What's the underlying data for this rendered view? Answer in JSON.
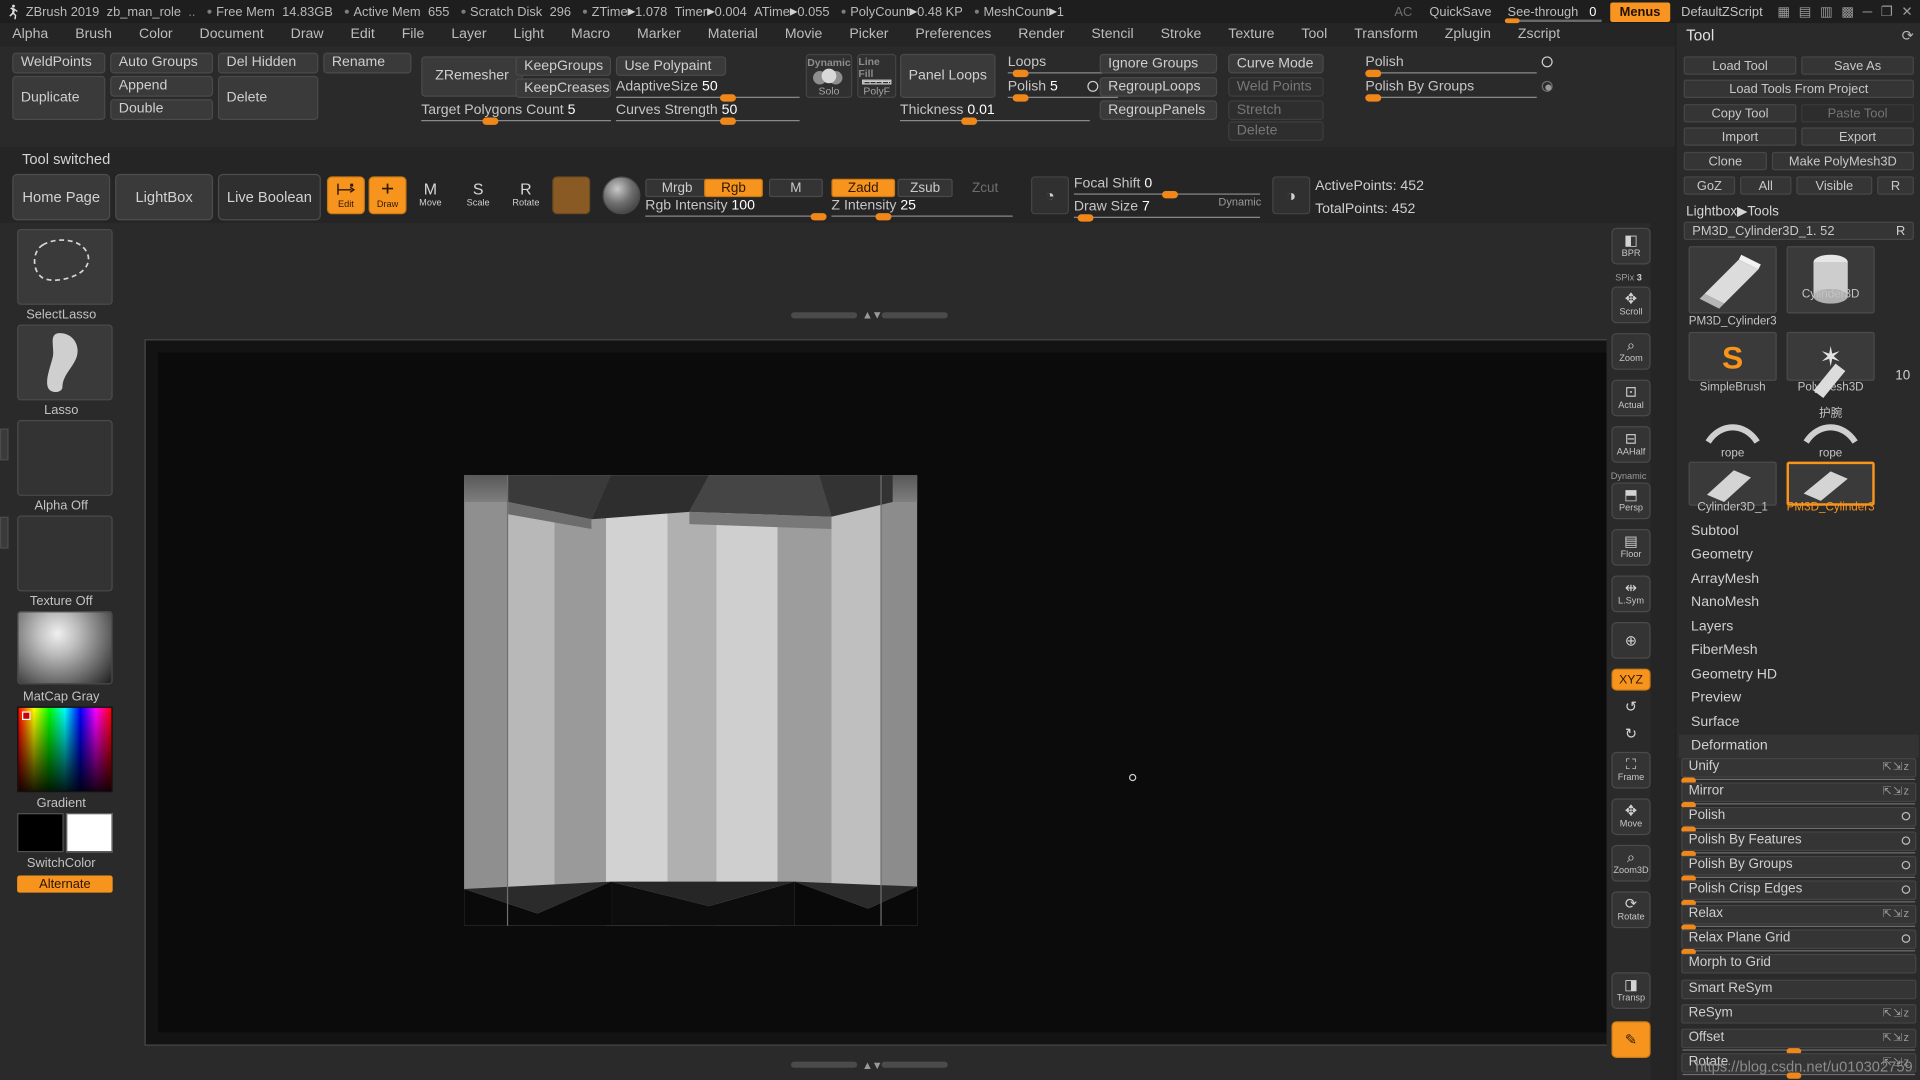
{
  "titlebar": {
    "app_name": "ZBrush 2019",
    "project": "zb_man_role",
    "ellipsis": "..",
    "stats": [
      {
        "label": "Free Mem",
        "value": "14.83GB"
      },
      {
        "label": "Active Mem",
        "value": "655"
      },
      {
        "label": "Scratch Disk",
        "value": "296"
      },
      {
        "label": "ZTime",
        "value": "1.078",
        "arrow": true
      },
      {
        "label": "Timer",
        "value": "0.004",
        "arrow": true
      },
      {
        "label": "ATime",
        "value": "0.055",
        "arrow": true
      },
      {
        "label": "PolyCount",
        "value": "0.48 KP",
        "arrow": true
      },
      {
        "label": "MeshCount",
        "value": "1",
        "arrow": true
      }
    ],
    "ac": "AC",
    "quicksave": "QuickSave",
    "seethrough_label": "See-through",
    "seethrough_value": "0",
    "menus": "Menus",
    "default_zscript": "DefaultZScript",
    "win_minimize": "minimize-icon",
    "win_maximize": "maximize-icon",
    "win_close": "close-icon"
  },
  "menubar": [
    "Alpha",
    "Brush",
    "Color",
    "Document",
    "Draw",
    "Edit",
    "File",
    "Layer",
    "Light",
    "Macro",
    "Marker",
    "Material",
    "Movie",
    "Picker",
    "Preferences",
    "Render",
    "Stencil",
    "Stroke",
    "Texture",
    "Tool",
    "Transform",
    "Zplugin",
    "Zscript"
  ],
  "shelf": {
    "group_mesh": [
      "WeldPoints",
      "Auto Groups",
      "Del Hidden",
      "Rename",
      "Duplicate",
      "Append",
      "Double",
      "Delete"
    ],
    "zremesher": "ZRemesher",
    "keep_groups": "KeepGroups",
    "keep_creases": "KeepCreases",
    "target_polygons": {
      "label": "Target Polygons Count",
      "value": "5"
    },
    "use_polypaint": "Use Polypaint",
    "adaptive_size": {
      "label": "AdaptiveSize",
      "value": "50"
    },
    "curves_strength": {
      "label": "Curves Strength",
      "value": "50"
    },
    "dynamic": {
      "cap": "Dynamic",
      "name": "Solo"
    },
    "linefill": {
      "cap": "Line Fill",
      "name": "PolyF"
    },
    "panel_loops": "Panel Loops",
    "thickness": {
      "label": "Thickness",
      "value": "0.01"
    },
    "loops": {
      "label": "Loops",
      "value": ""
    },
    "polish": {
      "label": "Polish",
      "value": "5"
    },
    "ignore_groups": "Ignore Groups",
    "regroup_loops": "RegroupLoops",
    "regroup_panels": "RegroupPanels",
    "curve_mode": "Curve Mode",
    "weld_points": "Weld Points",
    "stretch": "Stretch",
    "delete": "Delete",
    "polish_slider": "Polish",
    "polish_by_groups_slider": "Polish By Groups"
  },
  "status": "Tool switched",
  "toolrow": {
    "home_page": "Home Page",
    "lightbox": "LightBox",
    "live_boolean": "Live Boolean",
    "edit": "Edit",
    "draw": "Draw",
    "move": "Move",
    "scale": "Scale",
    "rotate": "Rotate",
    "mrgb": "Mrgb",
    "rgb": "Rgb",
    "m": "M",
    "zadd": "Zadd",
    "zsub": "Zsub",
    "zcut": "Zcut",
    "rgb_intensity": {
      "label": "Rgb Intensity",
      "value": "100"
    },
    "z_intensity": {
      "label": "Z Intensity",
      "value": "25"
    },
    "focal_shift": {
      "label": "Focal Shift",
      "value": "0"
    },
    "draw_size": {
      "label": "Draw Size",
      "value": "7"
    },
    "dynamic": "Dynamic",
    "active_points": "ActivePoints: 452",
    "total_points": "TotalPoints: 452"
  },
  "leftbar": {
    "brush_label": "SelectLasso",
    "stroke_label": "Lasso",
    "alpha_label": "Alpha Off",
    "texture_label": "Texture Off",
    "material_label": "MatCap Gray",
    "gradient_label": "Gradient",
    "switchcolor_label": "SwitchColor",
    "alternate_label": "Alternate",
    "current_tool_label": "护腕"
  },
  "right_minibar": [
    {
      "name": "BPR",
      "cap": "BPR"
    },
    {
      "name": "Scroll",
      "cap": "Scroll"
    },
    {
      "name": "Zoom",
      "cap": "Zoom"
    },
    {
      "name": "Actual",
      "cap": "Actual"
    },
    {
      "name": "AAHalf",
      "cap": "AAHalf"
    },
    {
      "name": "Persp",
      "cap": "Persp",
      "sublabel": "Dynamic"
    },
    {
      "name": "Floor",
      "cap": "Floor"
    },
    {
      "name": "LSym",
      "cap": "L.Sym"
    },
    {
      "name": "Local",
      "cap": ""
    },
    {
      "name": "XYZ",
      "cap": "XYZ",
      "on": true
    },
    {
      "name": "Frame",
      "cap": "Frame"
    },
    {
      "name": "Move",
      "cap": "Move"
    },
    {
      "name": "Zoom3D",
      "cap": "Zoom3D"
    },
    {
      "name": "Rotate",
      "cap": "Rotate"
    },
    {
      "name": "Transp",
      "cap": "Transp"
    }
  ],
  "spix": {
    "label": "SPix",
    "value": "3"
  },
  "right_panel": {
    "title": "Tool",
    "buttons_row1": [
      "Load Tool",
      "Save As"
    ],
    "buttons_row2": [
      "Load Tools From Project"
    ],
    "buttons_row3": [
      "Copy Tool",
      "Paste Tool"
    ],
    "buttons_row4": [
      "Import",
      "Export"
    ],
    "buttons_row5": [
      "Clone",
      "Make PolyMesh3D"
    ],
    "goz_row": [
      "GoZ",
      "All",
      "Visible",
      "R"
    ],
    "lightbox_tools": "Lightbox▶Tools",
    "current_tool": "PM3D_Cylinder3D_1. 52",
    "current_tool_r": "R",
    "thumbs": [
      {
        "name": "PM3D_Cylinder3",
        "selected": false
      },
      {
        "name": "Cylinder3D",
        "selected": false
      },
      {
        "name": "SimpleBrush",
        "selected": false
      },
      {
        "name": "PolyMesh3D",
        "selected": false
      },
      {
        "name": "护腕",
        "selected": false,
        "badge": "10"
      },
      {
        "name": "rope",
        "selected": false
      },
      {
        "name": "rope",
        "selected": false
      },
      {
        "name": "Cylinder3D_1",
        "selected": false
      },
      {
        "name": "PM3D_Cylinder3",
        "selected": true
      }
    ],
    "sections": [
      "Subtool",
      "Geometry",
      "ArrayMesh",
      "NanoMesh",
      "Layers",
      "FiberMesh",
      "Geometry HD",
      "Preview",
      "Surface",
      "Deformation"
    ],
    "deformations": [
      {
        "label": "Unify",
        "xyz": "⇱⇲z"
      },
      {
        "label": "Mirror",
        "xyz": "⇱⇲z"
      },
      {
        "label": "Polish",
        "dot": true
      },
      {
        "label": "Polish By Features",
        "dot": true
      },
      {
        "label": "Polish By Groups",
        "dot": true
      },
      {
        "label": "Polish Crisp Edges",
        "dot": true
      },
      {
        "label": "Relax",
        "xyz": "⇱⇲z"
      },
      {
        "label": "Relax Plane Grid",
        "dot": true
      },
      {
        "label": "Morph to Grid",
        "dot": false
      },
      {
        "label": "Smart ReSym",
        "xyz": ""
      },
      {
        "label": "ReSym",
        "xyz": "⇱⇲z"
      },
      {
        "label": "Offset",
        "xyz": "⇱⇲z"
      },
      {
        "label": "Rotate",
        "xyz": "⇱⇲z"
      }
    ]
  },
  "watermark": "https://blog.csdn.net/u010302759"
}
